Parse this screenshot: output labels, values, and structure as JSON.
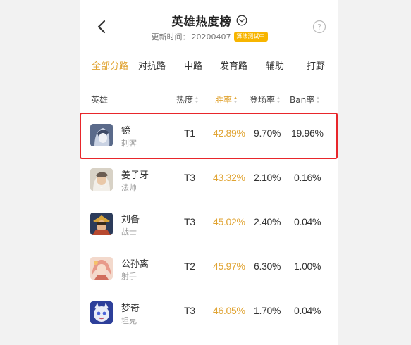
{
  "header": {
    "title": "英雄热度榜",
    "update_label": "更新时间：",
    "update_date": "20200407",
    "badge": "算法测试中"
  },
  "tabs": [
    {
      "label": "全部分路",
      "active": true
    },
    {
      "label": "对抗路"
    },
    {
      "label": "中路"
    },
    {
      "label": "发育路"
    },
    {
      "label": "辅助"
    },
    {
      "label": "打野"
    }
  ],
  "columns": {
    "hero": "英雄",
    "heat": "热度",
    "win_rate": "胜率",
    "pick_rate": "登场率",
    "ban_rate": "Ban率"
  },
  "rows": [
    {
      "name": "镜",
      "role": "刺客",
      "tier": "T1",
      "win": "42.89%",
      "pick": "9.70%",
      "ban": "19.96%"
    },
    {
      "name": "姜子牙",
      "role": "法师",
      "tier": "T3",
      "win": "43.32%",
      "pick": "2.10%",
      "ban": "0.16%"
    },
    {
      "name": "刘备",
      "role": "战士",
      "tier": "T3",
      "win": "45.02%",
      "pick": "2.40%",
      "ban": "0.04%"
    },
    {
      "name": "公孙离",
      "role": "射手",
      "tier": "T2",
      "win": "45.97%",
      "pick": "6.30%",
      "ban": "1.00%"
    },
    {
      "name": "梦奇",
      "role": "坦克",
      "tier": "T3",
      "win": "46.05%",
      "pick": "1.70%",
      "ban": "0.04%"
    }
  ],
  "colors": {
    "accent": "#e0a331",
    "badge": "#f7b500",
    "highlight_border": "#e8262b"
  },
  "icons": [
    "back-arrow-icon",
    "chevron-down-icon",
    "help-icon",
    "sort-icon"
  ]
}
